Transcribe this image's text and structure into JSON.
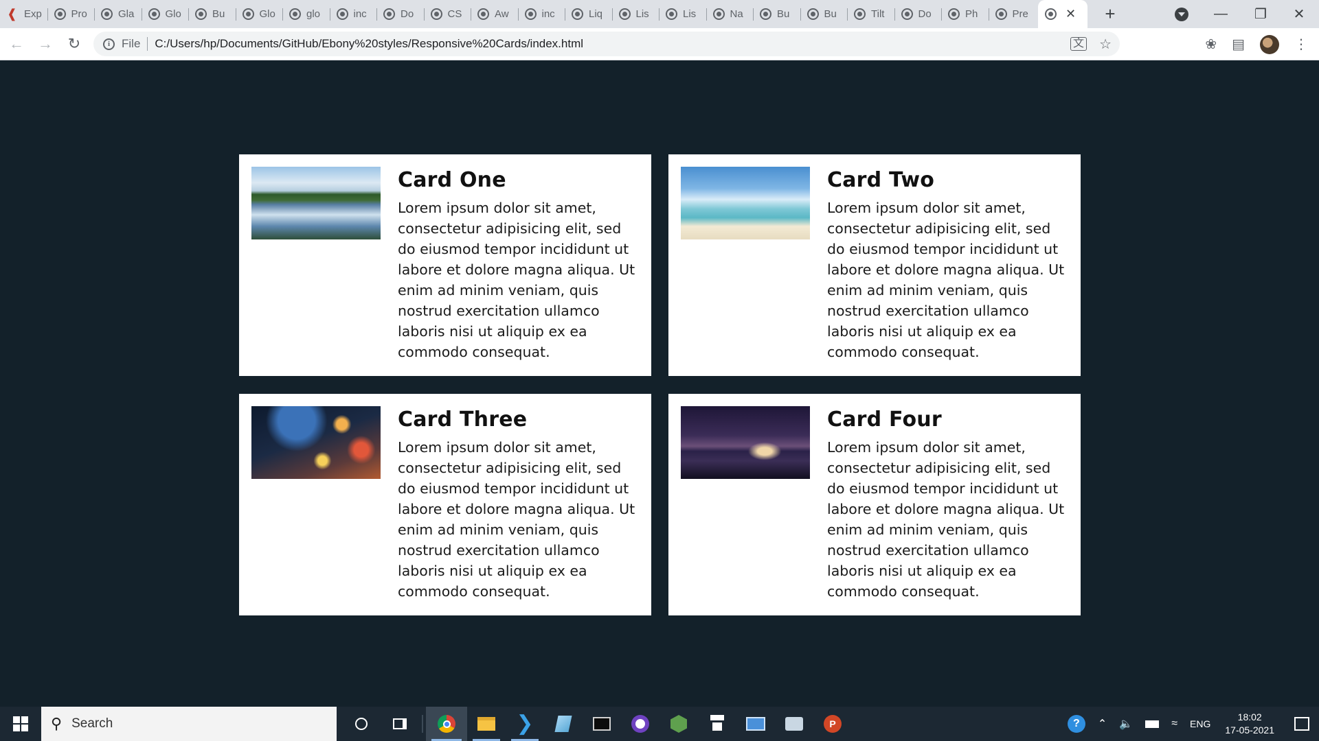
{
  "browser": {
    "tabs": [
      {
        "label": "Exp"
      },
      {
        "label": "Pro"
      },
      {
        "label": "Gla"
      },
      {
        "label": "Glo"
      },
      {
        "label": "Bu"
      },
      {
        "label": "Glo"
      },
      {
        "label": "glo"
      },
      {
        "label": "inc"
      },
      {
        "label": "Do"
      },
      {
        "label": "CS"
      },
      {
        "label": "Aw"
      },
      {
        "label": "inc"
      },
      {
        "label": "Liq"
      },
      {
        "label": "Lis"
      },
      {
        "label": "Lis"
      },
      {
        "label": "Na"
      },
      {
        "label": "Bu"
      },
      {
        "label": "Bu"
      },
      {
        "label": "Tilt"
      },
      {
        "label": "Do"
      },
      {
        "label": "Ph"
      },
      {
        "label": "Pre"
      }
    ],
    "active_tab_close": "✕",
    "new_tab": "+",
    "address": {
      "scheme": "File",
      "url": "C:/Users/hp/Documents/GitHub/Ebony%20styles/Responsive%20Cards/index.html"
    }
  },
  "cards": [
    {
      "title": "Card One",
      "text": "Lorem ipsum dolor sit amet, consectetur adipisicing elit, sed do eiusmod tempor incididunt ut labore et dolore magna aliqua. Ut enim ad minim veniam, quis nostrud exercitation ullamco laboris nisi ut aliquip ex ea commodo consequat."
    },
    {
      "title": "Card Two",
      "text": "Lorem ipsum dolor sit amet, consectetur adipisicing elit, sed do eiusmod tempor incididunt ut labore et dolore magna aliqua. Ut enim ad minim veniam, quis nostrud exercitation ullamco laboris nisi ut aliquip ex ea commodo consequat."
    },
    {
      "title": "Card Three",
      "text": "Lorem ipsum dolor sit amet, consectetur adipisicing elit, sed do eiusmod tempor incididunt ut labore et dolore magna aliqua. Ut enim ad minim veniam, quis nostrud exercitation ullamco laboris nisi ut aliquip ex ea commodo consequat."
    },
    {
      "title": "Card Four",
      "text": "Lorem ipsum dolor sit amet, consectetur adipisicing elit, sed do eiusmod tempor incididunt ut labore et dolore magna aliqua. Ut enim ad minim veniam, quis nostrud exercitation ullamco laboris nisi ut aliquip ex ea commodo consequat."
    }
  ],
  "taskbar": {
    "search_label": "Search",
    "language": "ENG",
    "time": "18:02",
    "date": "17-05-2021"
  },
  "colors": {
    "page_background": "#13212a",
    "card_background": "#ffffff",
    "taskbar_background": "#1c2833"
  }
}
